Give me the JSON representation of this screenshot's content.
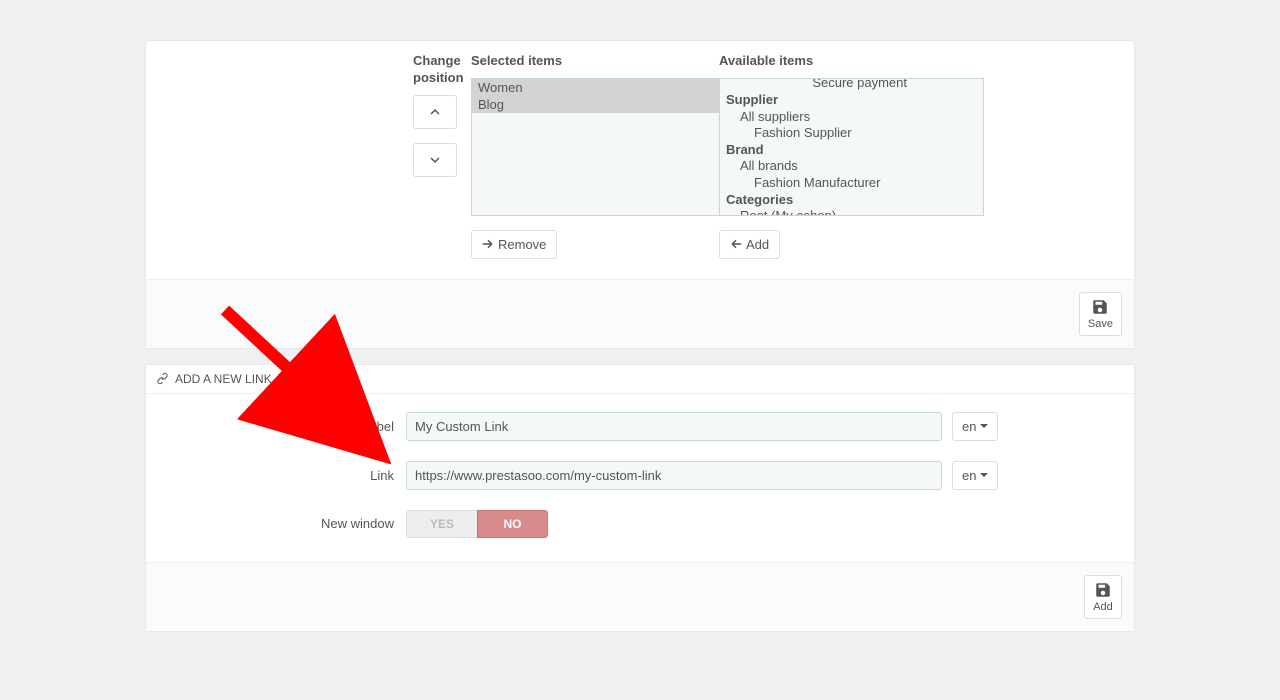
{
  "top_panel": {
    "change_position_label": "Change position",
    "selected_items_label": "Selected items",
    "available_items_label": "Available items",
    "selected_items": [
      "Women",
      "Blog"
    ],
    "available_items": [
      {
        "text": "Secure payment",
        "level": 2,
        "truncated": true
      },
      {
        "text": "Supplier",
        "level": 0
      },
      {
        "text": "All suppliers",
        "level": 1
      },
      {
        "text": "Fashion Supplier",
        "level": 2
      },
      {
        "text": "Brand",
        "level": 0
      },
      {
        "text": "All brands",
        "level": 1
      },
      {
        "text": "Fashion Manufacturer",
        "level": 2
      },
      {
        "text": "Categories",
        "level": 0
      },
      {
        "text": "Root (My eshop)",
        "level": 1
      }
    ],
    "remove_label": "Remove",
    "add_label": "Add",
    "save_label": "Save"
  },
  "link_panel": {
    "header": "ADD A NEW LINK",
    "label_field_label": "Label",
    "label_value": "My Custom Link",
    "link_field_label": "Link",
    "link_value": "https://www.prestasoo.com/my-custom-link",
    "new_window_label": "New window",
    "lang": "en",
    "toggle_yes": "YES",
    "toggle_no": "NO",
    "add_label": "Add"
  }
}
